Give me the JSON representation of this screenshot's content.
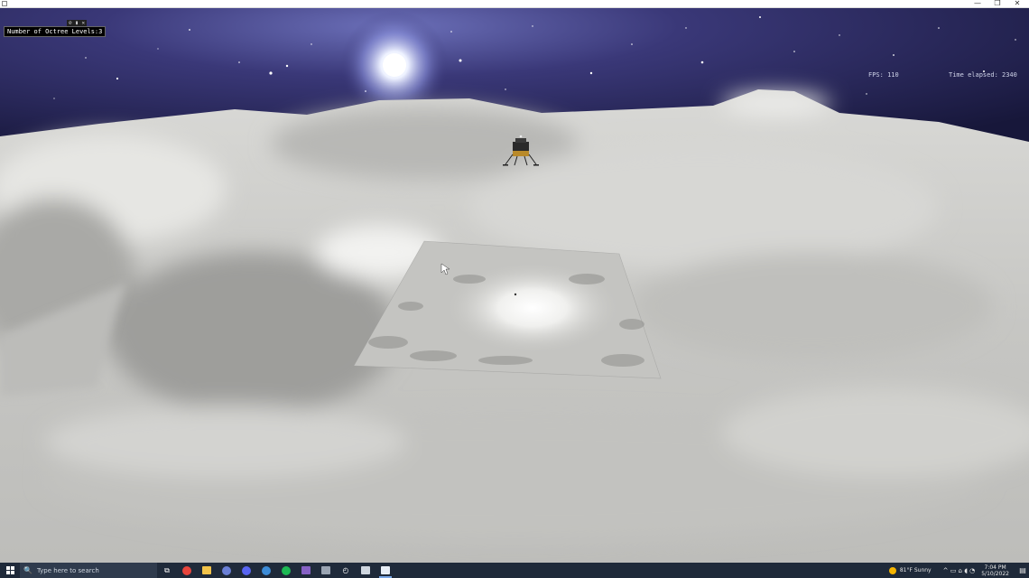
{
  "window": {
    "minimize_glyph": "—",
    "maximize_glyph": "❐",
    "close_glyph": "✕"
  },
  "hud": {
    "octree_label": "Number of Octree Levels:3",
    "octree_controls": "⊘ ▮ ✕",
    "fps_text": "FPS: 110",
    "time_text": "Time elapsed: 2340"
  },
  "scene": {
    "sky_color": "#20204a",
    "terrain_color": "#c9c9c6",
    "lander_icon": "lunar-lander-icon",
    "sun_icon": "bright-star-icon"
  },
  "taskbar": {
    "search_placeholder": "Type here to search",
    "search_icon": "🔍",
    "apps": [
      {
        "name": "task-view",
        "glyph": "⧉"
      },
      {
        "name": "chrome",
        "color": "#e8453c"
      },
      {
        "name": "file-explorer",
        "color": "#f2c34a"
      },
      {
        "name": "chat",
        "color": "#6a7fd6"
      },
      {
        "name": "discord",
        "color": "#5865f2"
      },
      {
        "name": "photos",
        "color": "#3d8cd8"
      },
      {
        "name": "spotify",
        "color": "#1db954"
      },
      {
        "name": "visual-studio",
        "color": "#8661c5"
      },
      {
        "name": "app-gray",
        "color": "#9aa4b2"
      },
      {
        "name": "clock-app",
        "glyph": "◴"
      },
      {
        "name": "terminal",
        "color": "#cfd6df"
      },
      {
        "name": "running-app",
        "color": "#e8eef6"
      }
    ],
    "weather": "81°F  Sunny",
    "tray_icons": "^ ▭ ⌂ ◖ ◔",
    "time": "7:04 PM",
    "date": "5/10/2022",
    "notif_glyph": "▤"
  }
}
